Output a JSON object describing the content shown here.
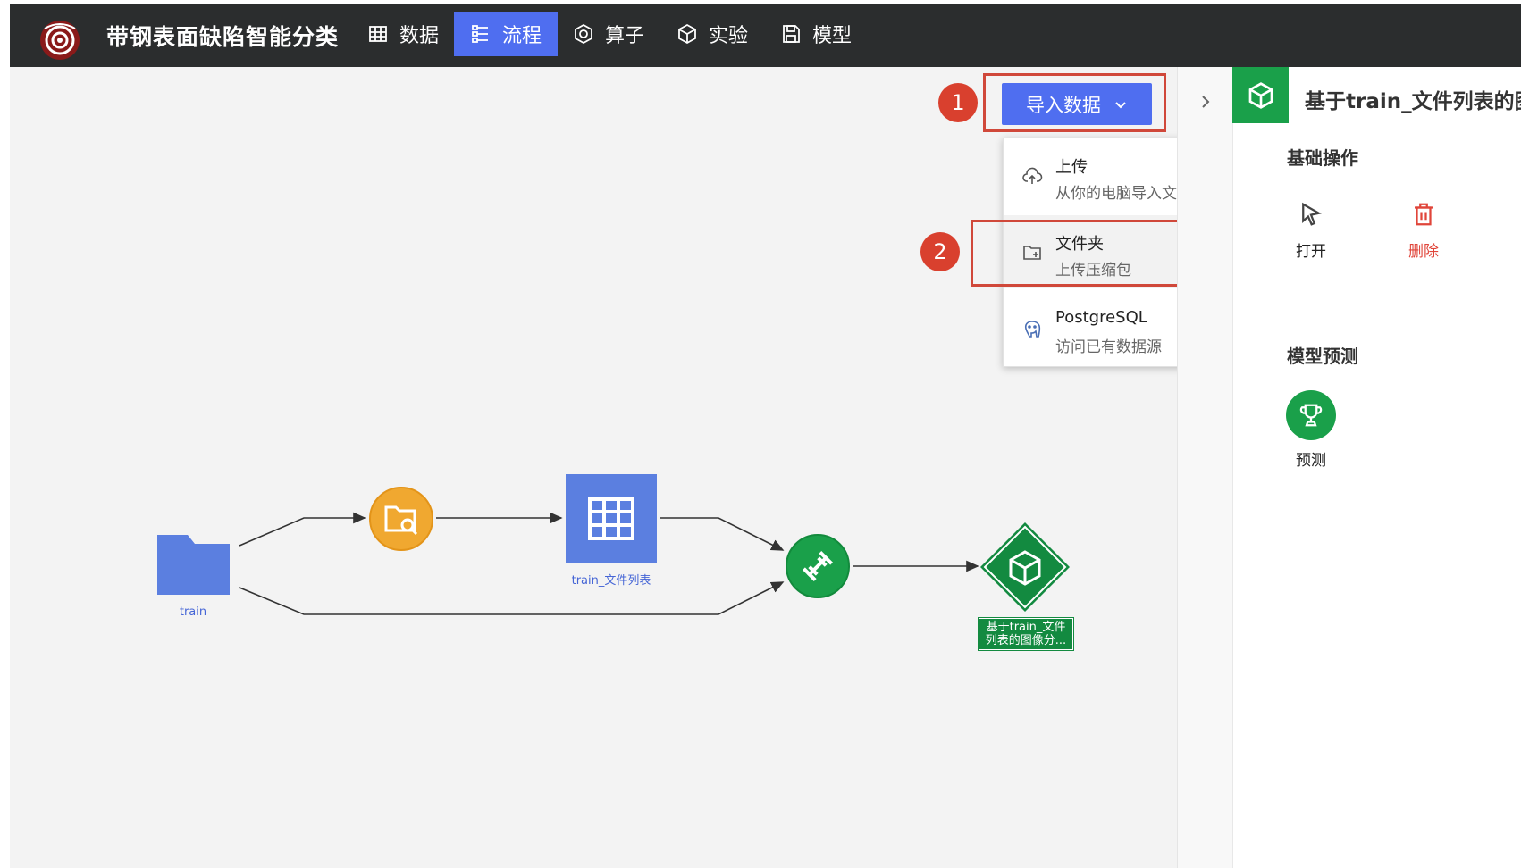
{
  "app": {
    "title": "带钢表面缺陷智能分类"
  },
  "nav": [
    {
      "label": "数据",
      "icon": "grid-icon",
      "active": false
    },
    {
      "label": "流程",
      "icon": "flow-icon",
      "active": true
    },
    {
      "label": "算子",
      "icon": "operator-icon",
      "active": false
    },
    {
      "label": "实验",
      "icon": "cube-icon",
      "active": false
    },
    {
      "label": "模型",
      "icon": "save-icon",
      "active": false
    }
  ],
  "toolbar": {
    "import_label": "导入数据"
  },
  "annotations": {
    "step1": "1",
    "step2": "2"
  },
  "dropdown": {
    "items": [
      {
        "title": "上传",
        "subtitle": "从你的电脑导入文件",
        "icon": "cloud-upload-icon"
      },
      {
        "title": "文件夹",
        "subtitle": "上传压缩包",
        "icon": "folder-add-icon"
      },
      {
        "title": "PostgreSQL",
        "subtitle": "访问已有数据源",
        "icon": "postgresql-icon"
      }
    ]
  },
  "flow": {
    "nodes": [
      {
        "id": "train",
        "label": "train",
        "type": "folder"
      },
      {
        "id": "scan",
        "label": "",
        "type": "file-search"
      },
      {
        "id": "table",
        "label": "train_文件列表",
        "type": "table"
      },
      {
        "id": "train-op",
        "label": "",
        "type": "dumbbell"
      },
      {
        "id": "model",
        "label_line1": "基于train_文件",
        "label_line2": "列表的图像分...",
        "type": "model"
      }
    ]
  },
  "panel": {
    "title": "基于train_文件列表的图",
    "basic_section": "基础操作",
    "open_label": "打开",
    "delete_label": "删除",
    "predict_section": "模型预测",
    "predict_label": "预测"
  },
  "colors": {
    "accent": "#4f6ef0",
    "topbar": "#2b2d2e",
    "green": "#1aa04a",
    "orange": "#f0a830",
    "annotation_red": "#d9402e",
    "delete_red": "#e0453a"
  }
}
